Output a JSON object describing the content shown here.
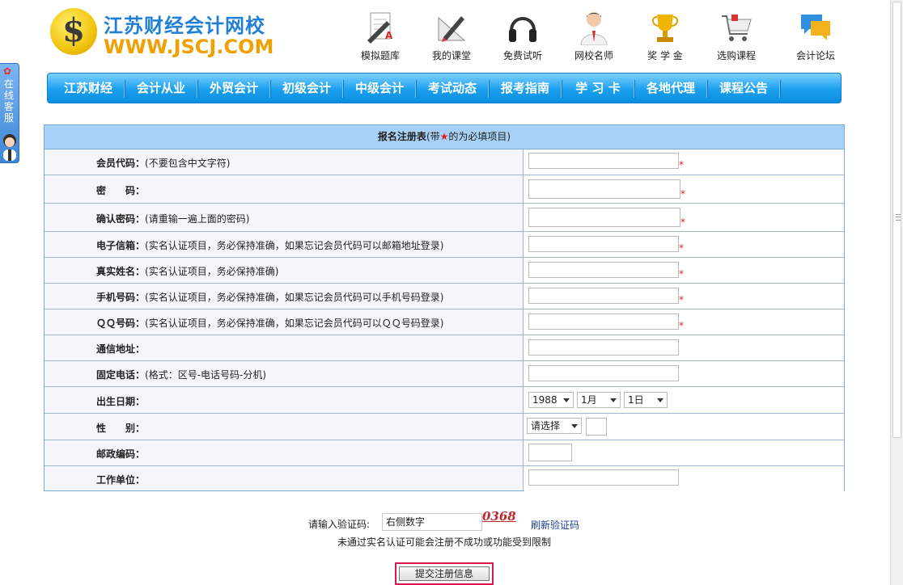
{
  "brand": {
    "logo_cn": "江苏财经会计网校",
    "logo_en": "WWW.JSCJ.COM",
    "coin_symbol": "$"
  },
  "side_service": {
    "text": "在线客服"
  },
  "top_links": [
    {
      "label": "模拟题库",
      "icon": "exam-paper-icon"
    },
    {
      "label": "我的课堂",
      "icon": "pen-ruler-icon"
    },
    {
      "label": "免费试听",
      "icon": "headphones-icon"
    },
    {
      "label": "网校名师",
      "icon": "teacher-icon"
    },
    {
      "label": "奖 学 金",
      "icon": "trophy-icon"
    },
    {
      "label": "选购课程",
      "icon": "shopping-cart-icon"
    },
    {
      "label": "会计论坛",
      "icon": "chat-bubble-icon"
    }
  ],
  "nav": [
    "江苏财经",
    "会计从业",
    "外贸会计",
    "初级会计",
    "中级会计",
    "考试动态",
    "报考指南",
    "学 习 卡",
    "各地代理",
    "课程公告"
  ],
  "form": {
    "title_bold": "报名注册表",
    "title_pre": "(带",
    "title_star": "★",
    "title_post": "的为必填项目)",
    "rows": [
      {
        "label": "会员代码：",
        "hint": "(不要包含中文字符)",
        "required": "*"
      },
      {
        "label": "密　　码：",
        "hint": "",
        "required": "*"
      },
      {
        "label": "确认密码：",
        "hint": "(请重输一遍上面的密码)",
        "required": "*"
      },
      {
        "label": "电子信箱：",
        "hint": "(实名认证项目，务必保持准确，如果忘记会员代码可以邮箱地址登录)",
        "required": "*"
      },
      {
        "label": "真实姓名：",
        "hint": "(实名认证项目，务必保持准确)",
        "required": "*"
      },
      {
        "label": "手机号码：",
        "hint": "(实名认证项目，务必保持准确，如果忘记会员代码可以手机号码登录)",
        "required": "*"
      },
      {
        "label": "ＱＱ号码：",
        "hint": "(实名认证项目，务必保持准确，如果忘记会员代码可以ＱＱ号码登录)",
        "required": "*"
      },
      {
        "label": "通信地址：",
        "hint": ""
      },
      {
        "label": "固定电话：",
        "hint": "(格式：区号-电话号码-分机)"
      },
      {
        "label": "出生日期：",
        "hint": ""
      },
      {
        "label": "性　　别：",
        "hint": ""
      },
      {
        "label": "邮政编码：",
        "hint": ""
      },
      {
        "label": "工作单位：",
        "hint": ""
      }
    ],
    "birth_year": "1988",
    "birth_month": "1月",
    "birth_day": "1日",
    "gender": "请选择"
  },
  "verify": {
    "label": "请输入验证码:",
    "input_value": "右侧数字",
    "code": "0368",
    "refresh": "刷新验证码"
  },
  "notice": "未通过实名认证可能会注册不成功或功能受到限制",
  "submit_label": "提交注册信息"
}
